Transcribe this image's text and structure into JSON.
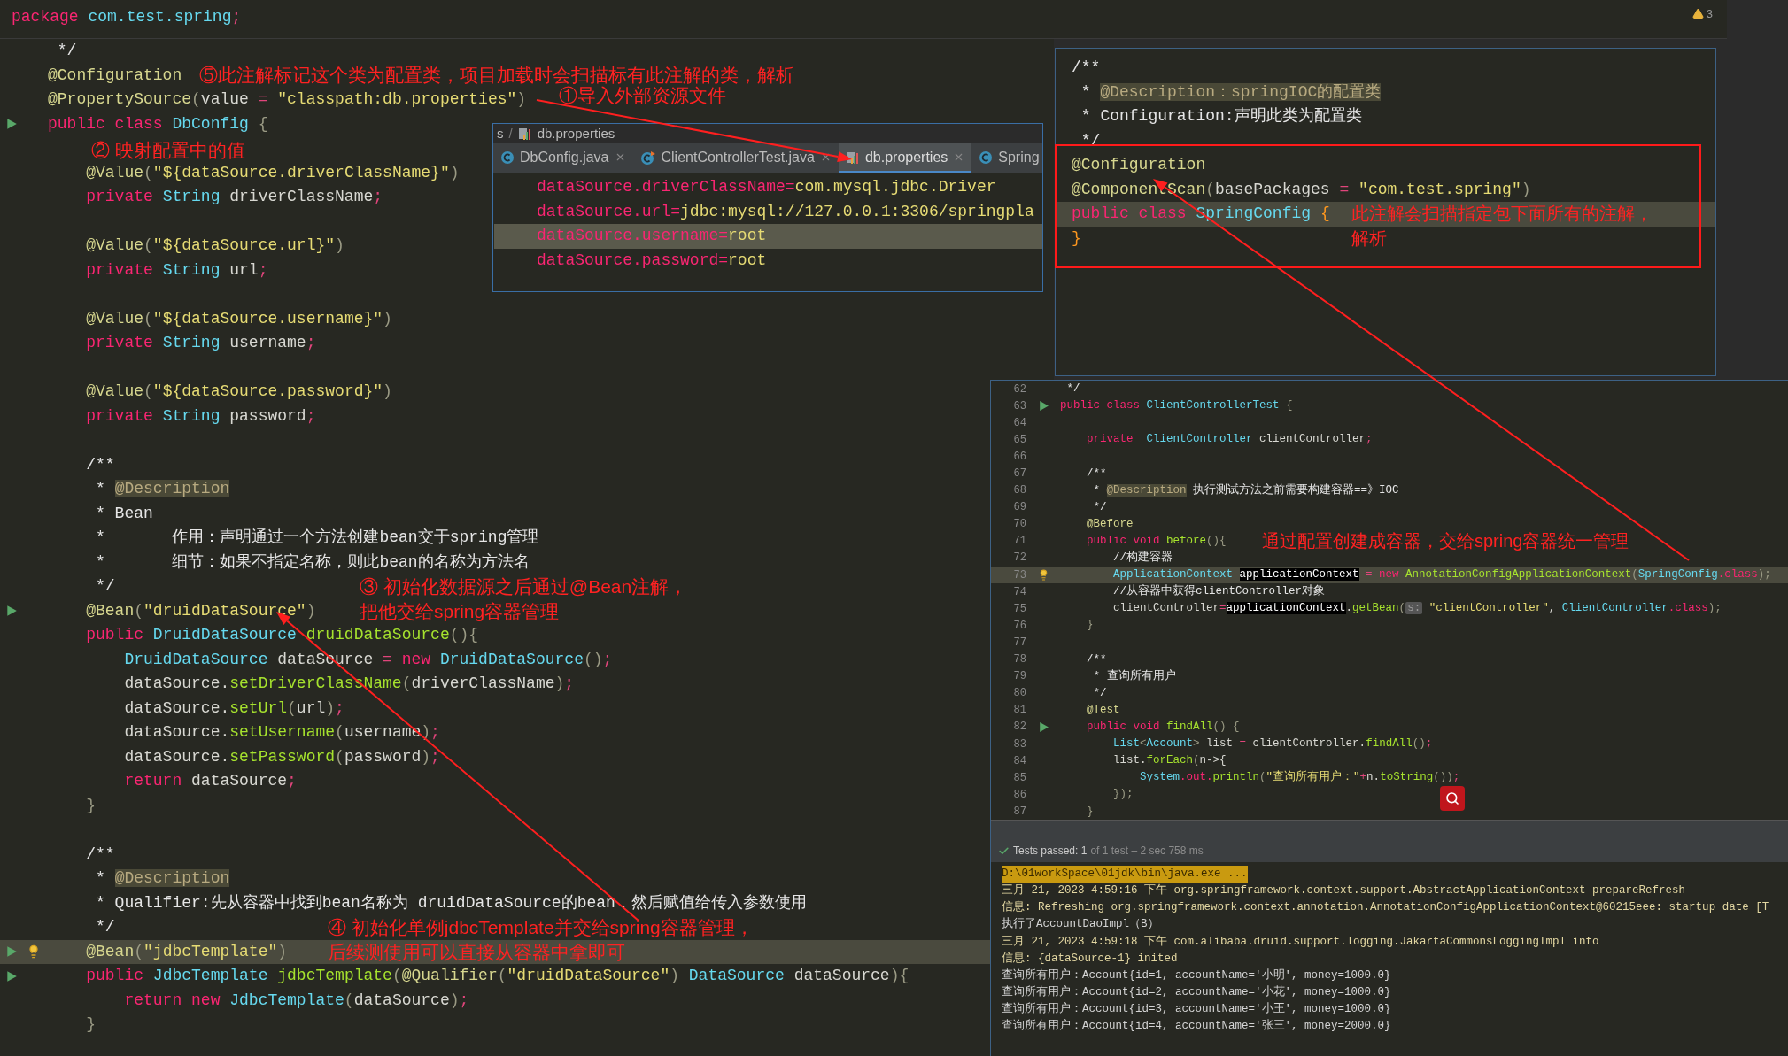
{
  "top_bar": {
    "segments": [
      {
        "kind": "kw",
        "text": "package "
      },
      {
        "kind": "type",
        "text": "com.test.spring"
      },
      {
        "kind": "op",
        "text": ";"
      }
    ],
    "warning_count": "3"
  },
  "editor": {
    "lines": [
      {
        "highlighted": false,
        "runnable": false,
        "has_bulb": false,
        "segments": [
          {
            "kind": "doc",
            "text": " */"
          }
        ]
      },
      {
        "highlighted": false,
        "runnable": false,
        "has_bulb": false,
        "segments": [
          {
            "kind": "ann",
            "text": "@Configuration"
          }
        ]
      },
      {
        "highlighted": false,
        "runnable": false,
        "has_bulb": false,
        "segments": [
          {
            "kind": "ann",
            "text": "@PropertySource"
          },
          {
            "kind": "paren",
            "text": "("
          },
          {
            "kind": "plain",
            "text": "value "
          },
          {
            "kind": "op",
            "text": "= "
          },
          {
            "kind": "str",
            "text": "\"classpath:db.properties\""
          },
          {
            "kind": "paren",
            "text": ")"
          }
        ]
      },
      {
        "highlighted": false,
        "runnable": true,
        "has_bulb": false,
        "segments": [
          {
            "kind": "kw",
            "text": "public class "
          },
          {
            "kind": "type",
            "text": "DbConfig "
          },
          {
            "kind": "paren",
            "text": "{"
          }
        ]
      },
      {
        "highlighted": false,
        "runnable": false,
        "has_bulb": false
      },
      {
        "highlighted": false,
        "runnable": false,
        "has_bulb": false,
        "segments": [
          {
            "kind": "ann",
            "text": "    @Value"
          },
          {
            "kind": "paren",
            "text": "("
          },
          {
            "kind": "str",
            "text": "\"${dataSource.driverClassName}\""
          },
          {
            "kind": "paren",
            "text": ")"
          }
        ]
      },
      {
        "highlighted": false,
        "runnable": false,
        "has_bulb": false,
        "segments": [
          {
            "kind": "kw",
            "text": "    private "
          },
          {
            "kind": "type",
            "text": "String "
          },
          {
            "kind": "plain",
            "text": "driverClassName"
          },
          {
            "kind": "op",
            "text": ";"
          }
        ]
      },
      {
        "highlighted": false,
        "runnable": false,
        "has_bulb": false
      },
      {
        "highlighted": false,
        "runnable": false,
        "has_bulb": false,
        "segments": [
          {
            "kind": "ann",
            "text": "    @Value"
          },
          {
            "kind": "paren",
            "text": "("
          },
          {
            "kind": "str",
            "text": "\"${dataSource.url}\""
          },
          {
            "kind": "paren",
            "text": ")"
          }
        ]
      },
      {
        "highlighted": false,
        "runnable": false,
        "has_bulb": false,
        "segments": [
          {
            "kind": "kw",
            "text": "    private "
          },
          {
            "kind": "type",
            "text": "String "
          },
          {
            "kind": "plain",
            "text": "url"
          },
          {
            "kind": "op",
            "text": ";"
          }
        ]
      },
      {
        "highlighted": false,
        "runnable": false,
        "has_bulb": false
      },
      {
        "highlighted": false,
        "runnable": false,
        "has_bulb": false,
        "segments": [
          {
            "kind": "ann",
            "text": "    @Value"
          },
          {
            "kind": "paren",
            "text": "("
          },
          {
            "kind": "str",
            "text": "\"${dataSource.username}\""
          },
          {
            "kind": "paren",
            "text": ")"
          }
        ]
      },
      {
        "highlighted": false,
        "runnable": false,
        "has_bulb": false,
        "segments": [
          {
            "kind": "kw",
            "text": "    private "
          },
          {
            "kind": "type",
            "text": "String "
          },
          {
            "kind": "plain",
            "text": "username"
          },
          {
            "kind": "op",
            "text": ";"
          }
        ]
      },
      {
        "highlighted": false,
        "runnable": false,
        "has_bulb": false
      },
      {
        "highlighted": false,
        "runnable": false,
        "has_bulb": false,
        "segments": [
          {
            "kind": "ann",
            "text": "    @Value"
          },
          {
            "kind": "paren",
            "text": "("
          },
          {
            "kind": "str",
            "text": "\"${dataSource.password}\""
          },
          {
            "kind": "paren",
            "text": ")"
          }
        ]
      },
      {
        "highlighted": false,
        "runnable": false,
        "has_bulb": false,
        "segments": [
          {
            "kind": "kw",
            "text": "    private "
          },
          {
            "kind": "type",
            "text": "String "
          },
          {
            "kind": "plain",
            "text": "password"
          },
          {
            "kind": "op",
            "text": ";"
          }
        ]
      },
      {
        "highlighted": false,
        "runnable": false,
        "has_bulb": false
      },
      {
        "highlighted": false,
        "runnable": false,
        "has_bulb": false,
        "segments": [
          {
            "kind": "doc",
            "text": "    /**"
          }
        ]
      },
      {
        "highlighted": false,
        "runnable": false,
        "has_bulb": false,
        "segments": [
          {
            "kind": "doc",
            "text": "     * "
          },
          {
            "kind": "tag",
            "text": "@Description"
          }
        ]
      },
      {
        "highlighted": false,
        "runnable": false,
        "has_bulb": false,
        "segments": [
          {
            "kind": "doc",
            "text": "     * Bean"
          }
        ]
      },
      {
        "highlighted": false,
        "runnable": false,
        "has_bulb": false,
        "segments": [
          {
            "kind": "doc",
            "text": "     *       作用：声明通过一个方法创建bean交于spring管理"
          }
        ]
      },
      {
        "highlighted": false,
        "runnable": false,
        "has_bulb": false,
        "segments": [
          {
            "kind": "doc",
            "text": "     *       细节：如果不指定名称，则此bean的名称为方法名"
          }
        ]
      },
      {
        "highlighted": false,
        "runnable": false,
        "has_bulb": false,
        "segments": [
          {
            "kind": "doc",
            "text": "     */"
          }
        ]
      },
      {
        "highlighted": false,
        "runnable": true,
        "has_bulb": false,
        "segments": [
          {
            "kind": "ann",
            "text": "    @Bean"
          },
          {
            "kind": "paren",
            "text": "("
          },
          {
            "kind": "str",
            "text": "\"druidDataSource\""
          },
          {
            "kind": "paren",
            "text": ")"
          }
        ]
      },
      {
        "highlighted": false,
        "runnable": false,
        "has_bulb": false,
        "segments": [
          {
            "kind": "kw",
            "text": "    public "
          },
          {
            "kind": "type",
            "text": "DruidDataSource "
          },
          {
            "kind": "fn",
            "text": "druidDataSource"
          },
          {
            "kind": "paren",
            "text": "(){"
          }
        ]
      },
      {
        "highlighted": false,
        "runnable": false,
        "has_bulb": false,
        "segments": [
          {
            "kind": "type",
            "text": "        DruidDataSource "
          },
          {
            "kind": "plain",
            "text": "dataSource "
          },
          {
            "kind": "op",
            "text": "= "
          },
          {
            "kind": "kw",
            "text": "new "
          },
          {
            "kind": "type",
            "text": "DruidDataSource"
          },
          {
            "kind": "paren",
            "text": "()"
          },
          {
            "kind": "op",
            "text": ";"
          }
        ]
      },
      {
        "highlighted": false,
        "runnable": false,
        "has_bulb": false,
        "segments": [
          {
            "kind": "plain",
            "text": "        dataSource."
          },
          {
            "kind": "fn",
            "text": "setDriverClassName"
          },
          {
            "kind": "paren",
            "text": "("
          },
          {
            "kind": "plain",
            "text": "driverClassName"
          },
          {
            "kind": "paren",
            "text": ")"
          },
          {
            "kind": "op",
            "text": ";"
          }
        ]
      },
      {
        "highlighted": false,
        "runnable": false,
        "has_bulb": false,
        "segments": [
          {
            "kind": "plain",
            "text": "        dataSource."
          },
          {
            "kind": "fn",
            "text": "setUrl"
          },
          {
            "kind": "paren",
            "text": "("
          },
          {
            "kind": "plain",
            "text": "url"
          },
          {
            "kind": "paren",
            "text": ")"
          },
          {
            "kind": "op",
            "text": ";"
          }
        ]
      },
      {
        "highlighted": false,
        "runnable": false,
        "has_bulb": false,
        "segments": [
          {
            "kind": "plain",
            "text": "        dataSource."
          },
          {
            "kind": "fn",
            "text": "setUsername"
          },
          {
            "kind": "paren",
            "text": "("
          },
          {
            "kind": "plain",
            "text": "username"
          },
          {
            "kind": "paren",
            "text": ")"
          },
          {
            "kind": "op",
            "text": ";"
          }
        ]
      },
      {
        "highlighted": false,
        "runnable": false,
        "has_bulb": false,
        "segments": [
          {
            "kind": "plain",
            "text": "        dataSource."
          },
          {
            "kind": "fn",
            "text": "setPassword"
          },
          {
            "kind": "paren",
            "text": "("
          },
          {
            "kind": "plain",
            "text": "password"
          },
          {
            "kind": "paren",
            "text": ")"
          },
          {
            "kind": "op",
            "text": ";"
          }
        ]
      },
      {
        "highlighted": false,
        "runnable": false,
        "has_bulb": false,
        "segments": [
          {
            "kind": "kw",
            "text": "        return "
          },
          {
            "kind": "plain",
            "text": "dataSource"
          },
          {
            "kind": "op",
            "text": ";"
          }
        ]
      },
      {
        "highlighted": false,
        "runnable": false,
        "has_bulb": false,
        "segments": [
          {
            "kind": "paren",
            "text": "    }"
          }
        ]
      },
      {
        "highlighted": false,
        "runnable": false,
        "has_bulb": false
      },
      {
        "highlighted": false,
        "runnable": false,
        "has_bulb": false,
        "segments": [
          {
            "kind": "doc",
            "text": "    /**"
          }
        ]
      },
      {
        "highlighted": false,
        "runnable": false,
        "has_bulb": false,
        "segments": [
          {
            "kind": "doc",
            "text": "     * "
          },
          {
            "kind": "tag",
            "text": "@Description"
          }
        ]
      },
      {
        "highlighted": false,
        "runnable": false,
        "has_bulb": false,
        "segments": [
          {
            "kind": "doc",
            "text": "     * Qualifier:先从容器中找到bean名称为 druidDataSource的bean，然后赋值给传入参数使用"
          }
        ]
      },
      {
        "highlighted": false,
        "runnable": false,
        "has_bulb": false,
        "segments": [
          {
            "kind": "doc",
            "text": "     */"
          }
        ]
      },
      {
        "highlighted": true,
        "runnable": true,
        "has_bulb": true,
        "segments": [
          {
            "kind": "ann",
            "text": "    @Bean"
          },
          {
            "kind": "paren",
            "text": "("
          },
          {
            "kind": "str",
            "text": "\"jdbcTemplate\""
          },
          {
            "kind": "paren",
            "text": ")"
          }
        ]
      },
      {
        "highlighted": false,
        "runnable": true,
        "has_bulb": false,
        "segments": [
          {
            "kind": "kw",
            "text": "    public "
          },
          {
            "kind": "type",
            "text": "JdbcTemplate "
          },
          {
            "kind": "fn",
            "text": "jdbcTemplate"
          },
          {
            "kind": "paren",
            "text": "("
          },
          {
            "kind": "ann",
            "text": "@Qualifier"
          },
          {
            "kind": "paren",
            "text": "("
          },
          {
            "kind": "str",
            "text": "\"druidDataSource\""
          },
          {
            "kind": "paren",
            "text": ") "
          },
          {
            "kind": "type",
            "text": "DataSource "
          },
          {
            "kind": "plain",
            "text": "dataSource"
          },
          {
            "kind": "paren",
            "text": "){"
          }
        ]
      },
      {
        "highlighted": false,
        "runnable": false,
        "has_bulb": false,
        "segments": [
          {
            "kind": "kw",
            "text": "        return new "
          },
          {
            "kind": "type",
            "text": "JdbcTemplate"
          },
          {
            "kind": "paren",
            "text": "("
          },
          {
            "kind": "plain",
            "text": "dataSource"
          },
          {
            "kind": "paren",
            "text": ")"
          },
          {
            "kind": "op",
            "text": ";"
          }
        ]
      },
      {
        "highlighted": false,
        "runnable": false,
        "has_bulb": false,
        "segments": [
          {
            "kind": "paren",
            "text": "    }"
          }
        ]
      }
    ]
  },
  "properties_popup": {
    "breadcrumb": {
      "items": [
        {
          "text": "s"
        },
        {
          "text": "db.properties"
        }
      ],
      "separator": "/"
    },
    "tabs": [
      {
        "label": "DbConfig.java",
        "selected": false,
        "closable": true
      },
      {
        "label": "ClientControllerTest.java",
        "selected": false,
        "closable": true
      },
      {
        "label": "db.properties",
        "selected": true,
        "closable": true
      },
      {
        "label": "Spring",
        "selected": false,
        "closable": false
      }
    ],
    "lines": [
      {
        "highlighted": false,
        "segments": [
          {
            "kind": "kw",
            "text": "dataSource.driverClassName"
          },
          {
            "kind": "kw",
            "text": "="
          },
          {
            "kind": "str",
            "text": "com.mysql.jdbc.Driver"
          }
        ]
      },
      {
        "highlighted": false,
        "segments": [
          {
            "kind": "kw",
            "text": "dataSource.url"
          },
          {
            "kind": "kw",
            "text": "="
          },
          {
            "kind": "str",
            "text": "jdbc:mysql://127.0.0.1:3306/springpla"
          }
        ]
      },
      {
        "highlighted": true,
        "segments": [
          {
            "kind": "kw",
            "text": "dataSource.username"
          },
          {
            "kind": "kw",
            "text": "="
          },
          {
            "kind": "str",
            "text": "root"
          }
        ]
      },
      {
        "highlighted": false,
        "segments": [
          {
            "kind": "kw",
            "text": "dataSource.password"
          },
          {
            "kind": "kw",
            "text": "="
          },
          {
            "kind": "str",
            "text": "root"
          }
        ]
      }
    ]
  },
  "config_panel": {
    "lines": [
      {
        "highlighted": false,
        "segments": [
          {
            "kind": "doc",
            "text": "/**"
          }
        ]
      },
      {
        "highlighted": false,
        "segments": [
          {
            "kind": "doc",
            "text": " * "
          },
          {
            "kind": "tag",
            "text": "@Description：springIOC的配置类"
          }
        ]
      },
      {
        "highlighted": false,
        "segments": [
          {
            "kind": "doc",
            "text": " * Configuration:声明此类为配置类"
          }
        ]
      },
      {
        "highlighted": false,
        "segments": [
          {
            "kind": "doc",
            "text": " */"
          }
        ]
      },
      {
        "highlighted": false,
        "segments": [
          {
            "kind": "ann",
            "text": "@Configuration"
          }
        ]
      },
      {
        "highlighted": false,
        "segments": [
          {
            "kind": "ann",
            "text": "@ComponentScan"
          },
          {
            "kind": "paren",
            "text": "("
          },
          {
            "kind": "plain",
            "text": "basePackages "
          },
          {
            "kind": "op",
            "text": "= "
          },
          {
            "kind": "str",
            "text": "\"com.test.spring\""
          },
          {
            "kind": "paren",
            "text": ")"
          }
        ]
      },
      {
        "highlighted": true,
        "segments": [
          {
            "kind": "kw",
            "text": "public class "
          },
          {
            "kind": "type",
            "text": "SpringConfig "
          },
          {
            "kind": "brace",
            "text": "{"
          }
        ]
      },
      {
        "highlighted": false,
        "segments": [
          {
            "kind": "brace",
            "text": "}"
          }
        ]
      }
    ]
  },
  "test_panel": {
    "lines": [
      {
        "number": "62",
        "highlighted": false,
        "runnable": false,
        "has_bulb": false,
        "segments": [
          {
            "kind": "doc",
            "text": " */"
          }
        ]
      },
      {
        "number": "63",
        "highlighted": false,
        "runnable": true,
        "has_bulb": false,
        "segments": [
          {
            "kind": "kw",
            "text": "public class "
          },
          {
            "kind": "type",
            "text": "ClientControllerTest "
          },
          {
            "kind": "paren",
            "text": "{"
          }
        ]
      },
      {
        "number": "64",
        "highlighted": false,
        "runnable": false,
        "has_bulb": false
      },
      {
        "number": "65",
        "highlighted": false,
        "runnable": false,
        "has_bulb": false,
        "segments": [
          {
            "kind": "kw",
            "text": "    private  "
          },
          {
            "kind": "type",
            "text": "ClientController "
          },
          {
            "kind": "plain",
            "text": "clientController"
          },
          {
            "kind": "op",
            "text": ";"
          }
        ]
      },
      {
        "number": "66",
        "highlighted": false,
        "runnable": false,
        "has_bulb": false
      },
      {
        "number": "67",
        "highlighted": false,
        "runnable": false,
        "has_bulb": false,
        "segments": [
          {
            "kind": "doc",
            "text": "    /**"
          }
        ]
      },
      {
        "number": "68",
        "highlighted": false,
        "runnable": false,
        "has_bulb": false,
        "segments": [
          {
            "kind": "doc",
            "text": "     * "
          },
          {
            "kind": "tag",
            "text": "@Description"
          },
          {
            "kind": "doc",
            "text": " 执行测试方法之前需要构建容器==》IOC"
          }
        ]
      },
      {
        "number": "69",
        "highlighted": false,
        "runnable": false,
        "has_bulb": false,
        "segments": [
          {
            "kind": "doc",
            "text": "     */"
          }
        ]
      },
      {
        "number": "70",
        "highlighted": false,
        "runnable": false,
        "has_bulb": false,
        "segments": [
          {
            "kind": "ann",
            "text": "    @Before"
          }
        ]
      },
      {
        "number": "71",
        "highlighted": false,
        "runnable": false,
        "has_bulb": false,
        "segments": [
          {
            "kind": "kw",
            "text": "    public void "
          },
          {
            "kind": "fn",
            "text": "before"
          },
          {
            "kind": "paren",
            "text": "(){"
          }
        ]
      },
      {
        "number": "72",
        "highlighted": false,
        "runnable": false,
        "has_bulb": false,
        "segments": [
          {
            "kind": "doc",
            "text": "        //构建容器"
          }
        ]
      },
      {
        "number": "73",
        "highlighted": true,
        "runnable": false,
        "has_bulb": true,
        "segments": [
          {
            "kind": "type",
            "text": "        ApplicationContext "
          },
          {
            "kind": "mark",
            "text": "applicationContext"
          },
          {
            "kind": "op",
            "text": " = "
          },
          {
            "kind": "kw",
            "text": "new "
          },
          {
            "kind": "fn",
            "text": "AnnotationConfigApplicationContext"
          },
          {
            "kind": "paren",
            "text": "("
          },
          {
            "kind": "type",
            "text": "SpringConfig"
          },
          {
            "kind": "kw",
            "text": ".class"
          },
          {
            "kind": "paren",
            "text": ");"
          }
        ]
      },
      {
        "number": "74",
        "highlighted": false,
        "runnable": false,
        "has_bulb": false,
        "segments": [
          {
            "kind": "doc",
            "text": "        //从容器中获得clientController对象"
          }
        ]
      },
      {
        "number": "75",
        "highlighted": false,
        "runnable": false,
        "has_bulb": false,
        "segments": [
          {
            "kind": "plain",
            "text": "        clientController"
          },
          {
            "kind": "op",
            "text": "="
          },
          {
            "kind": "mark",
            "text": "applicationContext"
          },
          {
            "kind": "plain",
            "text": "."
          },
          {
            "kind": "fn",
            "text": "getBean"
          },
          {
            "kind": "paren",
            "text": "("
          },
          {
            "kind": "hint",
            "text": "s:"
          },
          {
            "kind": "str",
            "text": " \"clientController\""
          },
          {
            "kind": "plain",
            "text": ", "
          },
          {
            "kind": "type",
            "text": "ClientController"
          },
          {
            "kind": "kw",
            "text": ".class"
          },
          {
            "kind": "paren",
            "text": ");"
          }
        ]
      },
      {
        "number": "76",
        "highlighted": false,
        "runnable": false,
        "has_bulb": false,
        "segments": [
          {
            "kind": "paren",
            "text": "    }"
          }
        ]
      },
      {
        "number": "77",
        "highlighted": false,
        "runnable": false,
        "has_bulb": false
      },
      {
        "number": "78",
        "highlighted": false,
        "runnable": false,
        "has_bulb": false,
        "segments": [
          {
            "kind": "doc",
            "text": "    /**"
          }
        ]
      },
      {
        "number": "79",
        "highlighted": false,
        "runnable": false,
        "has_bulb": false,
        "segments": [
          {
            "kind": "doc",
            "text": "     * 查询所有用户"
          }
        ]
      },
      {
        "number": "80",
        "highlighted": false,
        "runnable": false,
        "has_bulb": false,
        "segments": [
          {
            "kind": "doc",
            "text": "     */"
          }
        ]
      },
      {
        "number": "81",
        "highlighted": false,
        "runnable": false,
        "has_bulb": false,
        "segments": [
          {
            "kind": "ann",
            "text": "    @Test"
          }
        ]
      },
      {
        "number": "82",
        "highlighted": false,
        "runnable": true,
        "has_bulb": false,
        "segments": [
          {
            "kind": "kw",
            "text": "    public void "
          },
          {
            "kind": "fn",
            "text": "findAll"
          },
          {
            "kind": "paren",
            "text": "() {"
          }
        ]
      },
      {
        "number": "83",
        "highlighted": false,
        "runnable": false,
        "has_bulb": false,
        "segments": [
          {
            "kind": "type",
            "text": "        List"
          },
          {
            "kind": "paren",
            "text": "<"
          },
          {
            "kind": "type",
            "text": "Account"
          },
          {
            "kind": "paren",
            "text": "> "
          },
          {
            "kind": "plain",
            "text": "list "
          },
          {
            "kind": "op",
            "text": "= "
          },
          {
            "kind": "plain",
            "text": "clientController."
          },
          {
            "kind": "fn",
            "text": "findAll"
          },
          {
            "kind": "paren",
            "text": "()"
          },
          {
            "kind": "op",
            "text": ";"
          }
        ]
      },
      {
        "number": "84",
        "highlighted": false,
        "runnable": false,
        "has_bulb": false,
        "segments": [
          {
            "kind": "plain",
            "text": "        list."
          },
          {
            "kind": "fn",
            "text": "forEach"
          },
          {
            "kind": "paren",
            "text": "("
          },
          {
            "kind": "plain",
            "text": "n->{"
          }
        ]
      },
      {
        "number": "85",
        "highlighted": false,
        "runnable": false,
        "has_bulb": false,
        "segments": [
          {
            "kind": "type",
            "text": "            System"
          },
          {
            "kind": "kw",
            "text": ".out."
          },
          {
            "kind": "fn",
            "text": "println"
          },
          {
            "kind": "paren",
            "text": "("
          },
          {
            "kind": "str",
            "text": "\"查询所有用户：\""
          },
          {
            "kind": "op",
            "text": "+"
          },
          {
            "kind": "plain",
            "text": "n."
          },
          {
            "kind": "fn",
            "text": "toString"
          },
          {
            "kind": "paren",
            "text": "())"
          },
          {
            "kind": "op",
            "text": ";"
          }
        ]
      },
      {
        "number": "86",
        "highlighted": false,
        "runnable": false,
        "has_bulb": false,
        "segments": [
          {
            "kind": "paren",
            "text": "        });"
          }
        ]
      },
      {
        "number": "87",
        "highlighted": false,
        "runnable": false,
        "has_bulb": false,
        "segments": [
          {
            "kind": "paren",
            "text": "    }"
          }
        ]
      }
    ],
    "test_status": {
      "passed": true,
      "summary": "Tests passed: 1",
      "detail": "of 1 test – 2 sec 758 ms"
    },
    "console": [
      {
        "kind": "command",
        "text": "D:\\01workSpace\\01jdk\\bin\\java.exe ..."
      },
      {
        "kind": "log",
        "text": "三月 21, 2023 4:59:16 下午 org.springframework.context.support.AbstractApplicationContext prepareRefresh"
      },
      {
        "kind": "log",
        "text": "信息: Refreshing org.springframework.context.annotation.AnnotationConfigApplicationContext@60215eee: startup date [T"
      },
      {
        "kind": "output",
        "text": "执行了AccountDaoImpl（B）"
      },
      {
        "kind": "log",
        "text": "三月 21, 2023 4:59:18 下午 com.alibaba.druid.support.logging.JakartaCommonsLoggingImpl info"
      },
      {
        "kind": "log",
        "text": "信息: {dataSource-1} inited"
      },
      {
        "kind": "output",
        "text": "查询所有用户：Account{id=1, accountName='小明', money=1000.0}"
      },
      {
        "kind": "output",
        "text": "查询所有用户：Account{id=2, accountName='小花', money=1000.0}"
      },
      {
        "kind": "output",
        "text": "查询所有用户：Account{id=3, accountName='小王', money=1000.0}"
      },
      {
        "kind": "output",
        "text": "查询所有用户：Account{id=4, accountName='张三', money=2000.0}"
      }
    ]
  },
  "callouts": [
    {
      "lines": [
        "⑤此注解标记这个类为配置类，项目加载时会扫描标有此注解的类，解析"
      ]
    },
    {
      "lines": [
        "①导入外部资源文件"
      ]
    },
    {
      "lines": [
        "② 映射配置中的值"
      ]
    },
    {
      "lines": [
        "③ 初始化数据源之后通过@Bean注解，",
        "把他交给spring容器管理"
      ]
    },
    {
      "lines": [
        "④ 初始化单例jdbcTemplate并交给spring容器管理，",
        "后续测使用可以直接从容器中拿即可"
      ]
    },
    {
      "lines": [
        "此注解会扫描指定包下面所有的注解，",
        "解析"
      ]
    },
    {
      "lines": [
        "通过配置创建成容器，交给spring容器统一管理"
      ]
    }
  ]
}
